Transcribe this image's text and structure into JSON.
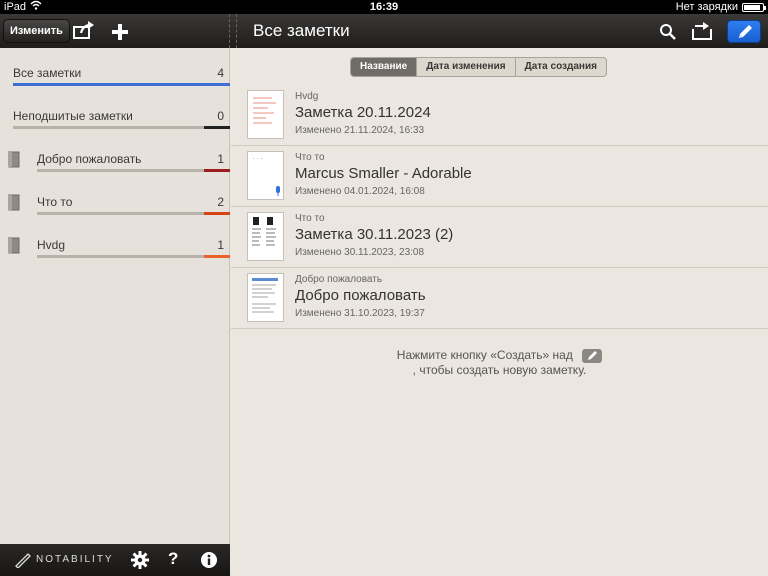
{
  "status": {
    "device": "iPad",
    "time": "16:39",
    "battery_text": "Нет зарядки",
    "battery_level": 0.9
  },
  "toolbar": {
    "edit_label": "Изменить",
    "title": "Все заметки",
    "accent": "#2f7ef0"
  },
  "sidebar": {
    "items": [
      {
        "label": "Все заметки",
        "count": "4",
        "color": "#3b6fd3"
      },
      {
        "label": "Неподшитые заметки",
        "count": "0",
        "color": "#222222"
      },
      {
        "label": "Добро пожаловать",
        "count": "1",
        "color": "#9b1d1d"
      },
      {
        "label": "Что то",
        "count": "2",
        "color": "#d84315"
      },
      {
        "label": "Hvdg",
        "count": "1",
        "color": "#e8622a"
      }
    ],
    "brand": "NOTABILITY"
  },
  "sort": {
    "options": [
      "Название",
      "Дата изменения",
      "Дата создания"
    ],
    "active": "Название"
  },
  "notes": [
    {
      "category": "Hvdg",
      "title": "Заметка 20.11.2024",
      "date": "Изменено 21.11.2024, 16:33"
    },
    {
      "category": "Что то",
      "title": "Marcus Smaller - Adorable",
      "date": "Изменено 04.01.2024, 16:08"
    },
    {
      "category": "Что то",
      "title": "Заметка 30.11.2023 (2)",
      "date": "Изменено 30.11.2023, 23:08"
    },
    {
      "category": "Добро пожаловать",
      "title": "Добро пожаловать",
      "date": "Изменено 31.10.2023, 19:37"
    }
  ],
  "hint": {
    "line1": "Нажмите кнопку «Создать» над",
    "line2": ", чтобы создать новую заметку."
  }
}
